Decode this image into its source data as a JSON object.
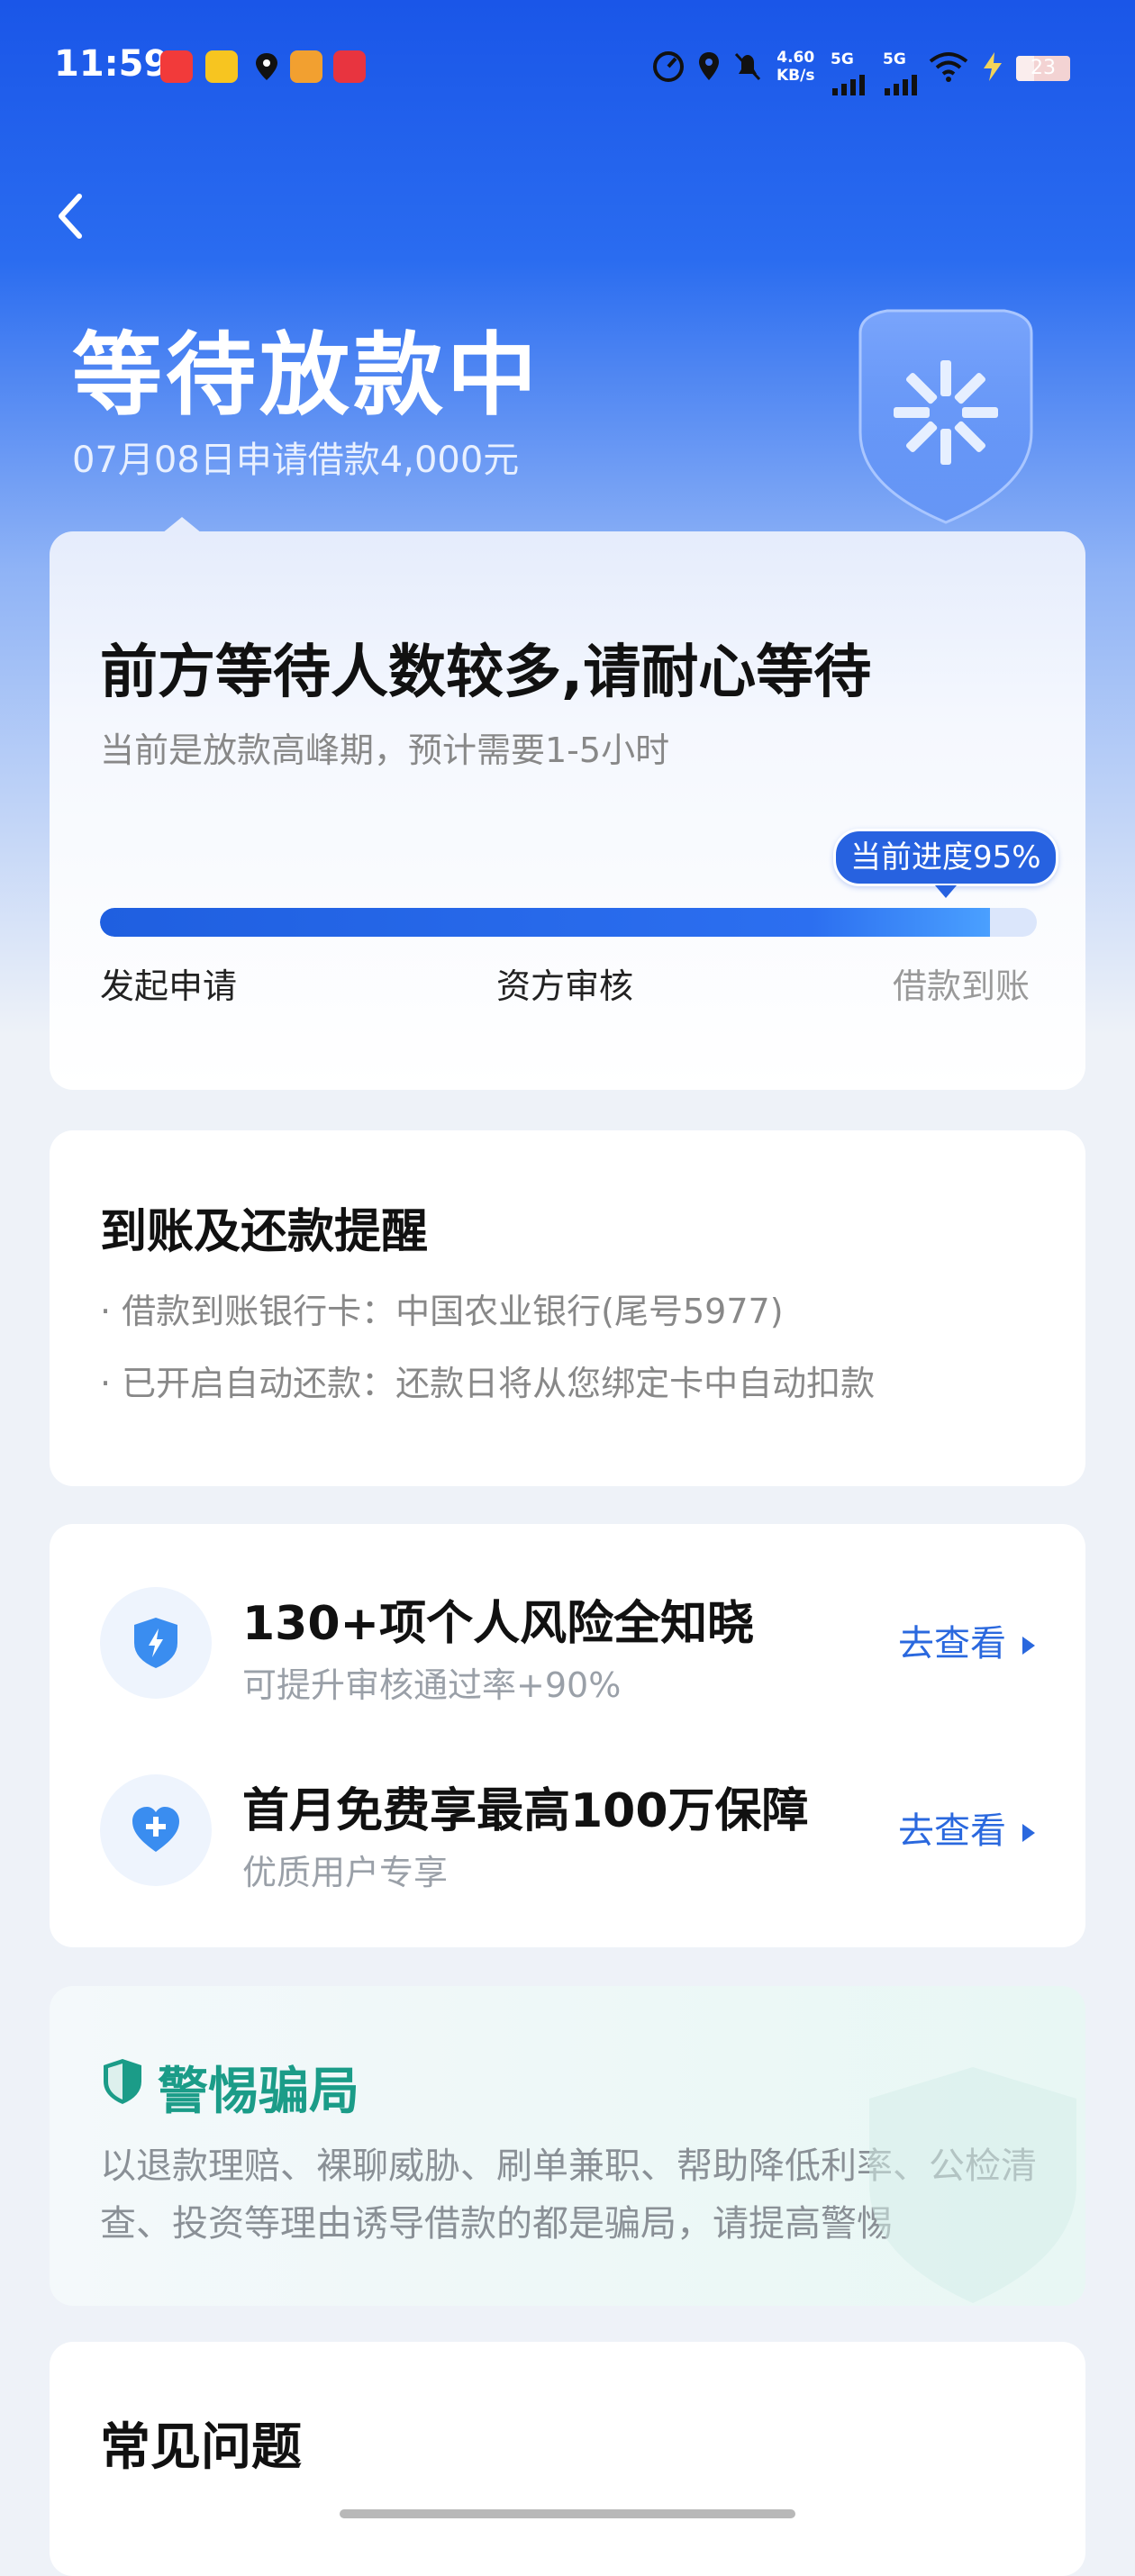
{
  "status_bar": {
    "time": "11:59",
    "net_speed_value": "4.60",
    "net_speed_unit": "KB/s",
    "signal1_label": "5G",
    "signal2_label": "5G",
    "battery": "23"
  },
  "header": {
    "title": "等待放款中",
    "subtitle": "07月08日申请借款4,000元"
  },
  "progress_card": {
    "headline": "前方等待人数较多,请耐心等待",
    "note": "当前是放款高峰期，预计需要1-5小时",
    "badge": "当前进度95%",
    "progress_percent": 95,
    "steps": [
      "发起申请",
      "资方审核",
      "借款到账"
    ]
  },
  "reminder_card": {
    "title": "到账及还款提醒",
    "items": [
      "· 借款到账银行卡：中国农业银行(尾号5977)",
      "· 已开启自动还款：还款日将从您绑定卡中自动扣款"
    ]
  },
  "promos": [
    {
      "title": "130+项个人风险全知晓",
      "subtitle": "可提升审核通过率+90%",
      "action": "去查看",
      "icon": "shield-bolt-icon"
    },
    {
      "title": "首月免费享最高100万保障",
      "subtitle": "优质用户专享",
      "action": "去查看",
      "icon": "heart-plus-icon"
    }
  ],
  "warning_card": {
    "title": "警惕骗局",
    "text": "以退款理赔、裸聊威胁、刷单兼职、帮助降低利率、公检清查、投资等理由诱导借款的都是骗局，请提高警惕"
  },
  "faq": {
    "title": "常见问题"
  },
  "colors": {
    "brand_blue": "#1a56e8",
    "accent_blue": "#2a68de",
    "warning_green": "#1b9c88"
  }
}
